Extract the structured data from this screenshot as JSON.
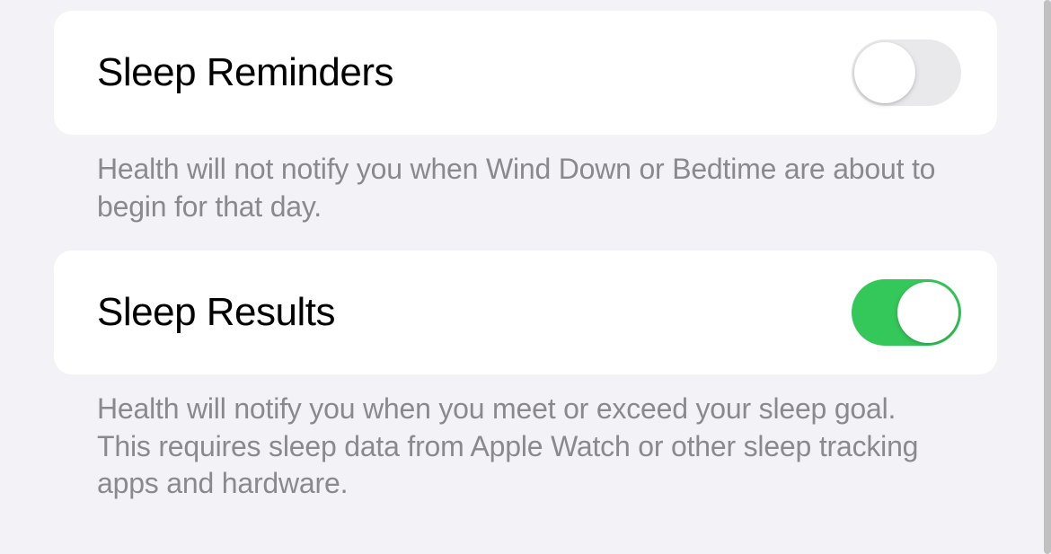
{
  "settings": [
    {
      "label": "Sleep Reminders",
      "enabled": false,
      "description": "Health will not notify you when Wind Down or Bedtime are about to begin for that day."
    },
    {
      "label": "Sleep Results",
      "enabled": true,
      "description": "Health will notify you when you meet or exceed your sleep goal. This requires sleep data from Apple Watch or other sleep tracking apps and hardware."
    }
  ],
  "colors": {
    "toggle_on": "#34c759",
    "toggle_off": "#e9e9eb",
    "background": "#f2f2f7",
    "row_bg": "#ffffff",
    "text_primary": "#000000",
    "text_secondary": "#8a8a8e"
  }
}
